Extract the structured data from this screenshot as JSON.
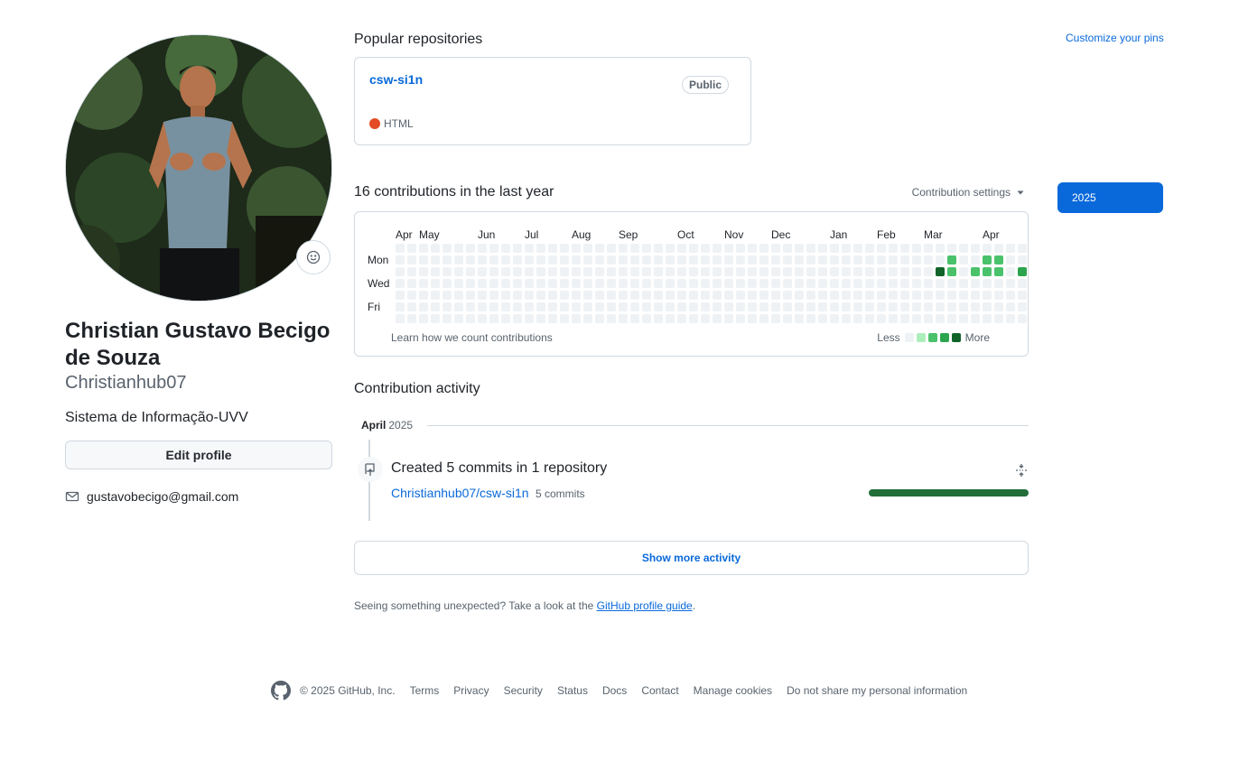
{
  "sidebar": {
    "fullname": "Christian Gustavo Becigo de Souza",
    "username": "Christianhub07",
    "bio": "Sistema de Informação-UVV",
    "edit_profile_label": "Edit profile",
    "email": "gustavobecigo@gmail.com"
  },
  "pins": {
    "title": "Popular repositories",
    "customize_label": "Customize your pins",
    "repo": {
      "name": "csw-si1n",
      "visibility": "Public",
      "language": "HTML",
      "language_color": "#e34c26"
    }
  },
  "contributions": {
    "title": "16 contributions in the last year",
    "settings_label": "Contribution settings",
    "months": [
      "Apr",
      "May",
      "Jun",
      "Jul",
      "Aug",
      "Sep",
      "Oct",
      "Nov",
      "Dec",
      "Jan",
      "Feb",
      "Mar",
      "Apr"
    ],
    "day_labels": [
      "Mon",
      "Wed",
      "Fri"
    ],
    "learn_label": "Learn how we count contributions",
    "legend_less": "Less",
    "legend_more": "More",
    "colors": [
      "#eff2f5",
      "#aceebb",
      "#4ac26b",
      "#2da44e",
      "#116329"
    ],
    "active_days": [
      {
        "week": 46,
        "day": 2,
        "level": 4
      },
      {
        "week": 47,
        "day": 1,
        "level": 2
      },
      {
        "week": 47,
        "day": 2,
        "level": 2
      },
      {
        "week": 49,
        "day": 2,
        "level": 2
      },
      {
        "week": 50,
        "day": 1,
        "level": 2
      },
      {
        "week": 50,
        "day": 2,
        "level": 2
      },
      {
        "week": 51,
        "day": 1,
        "level": 2
      },
      {
        "week": 51,
        "day": 2,
        "level": 2
      },
      {
        "week": 53,
        "day": 2,
        "level": 3
      },
      {
        "week": 54,
        "day": 2,
        "level": 4
      }
    ],
    "year_selected": "2025"
  },
  "activity": {
    "title": "Contribution activity",
    "month": "April",
    "year": "2025",
    "summary": "Created 5 commits in 1 repository",
    "repo_link": "Christianhub07/csw-si1n",
    "commit_count": "5 commits",
    "show_more_label": "Show more activity",
    "unexpected_text": "Seeing something unexpected? Take a look at the",
    "guide_link": "GitHub profile guide",
    "period": "."
  },
  "footer": {
    "copyright": "© 2025 GitHub, Inc.",
    "links": [
      "Terms",
      "Privacy",
      "Security",
      "Status",
      "Docs",
      "Contact",
      "Manage cookies",
      "Do not share my personal information"
    ]
  },
  "icons": {
    "status": "smiley-icon",
    "email": "mail-icon",
    "timeline": "repo-push-icon",
    "collapse": "fold-icon",
    "footer_logo": "github-mark-icon",
    "settings_caret": "triangle-down-icon"
  }
}
